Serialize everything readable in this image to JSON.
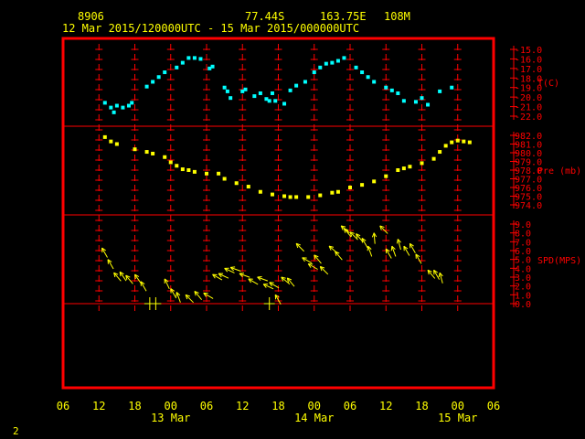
{
  "header": {
    "station_id": "8906",
    "latitude": "77.44S",
    "longitude": "163.75E",
    "elevation": "108M",
    "time_range": "12 Mar 2015/120000UTC - 15 Mar 2015/000000UTC"
  },
  "footer": {
    "page_number": "2"
  },
  "colors": {
    "frame": "#ff0000",
    "text": "#ffff00",
    "temperature": "#00ffff",
    "pressure": "#ffff00",
    "wind": "#ffff00"
  },
  "chart_data": {
    "type": "scatter",
    "x_axis": {
      "ticks": [
        "06",
        "12",
        "18",
        "00",
        "06",
        "12",
        "18",
        "00",
        "06",
        "12",
        "18",
        "00",
        "06"
      ],
      "tick_hours": [
        -6,
        0,
        6,
        12,
        18,
        24,
        30,
        36,
        42,
        48,
        54,
        60,
        66
      ],
      "date_labels": [
        {
          "text": "13 Mar",
          "hour": 12
        },
        {
          "text": "14 Mar",
          "hour": 36
        },
        {
          "text": "15 Mar",
          "hour": 60
        }
      ],
      "range_hours": [
        -6,
        66
      ]
    },
    "panels": [
      {
        "name": "temperature",
        "label": "T(C)",
        "ticks": [
          "-15.0",
          "-16.0",
          "-17.0",
          "-18.0",
          "-19.0",
          "-20.0",
          "-21.0",
          "-22.0"
        ],
        "range": [
          -22,
          -15
        ],
        "points": [
          [
            1,
            -20.6
          ],
          [
            2,
            -21.1
          ],
          [
            2.5,
            -21.6
          ],
          [
            3,
            -20.9
          ],
          [
            4,
            -21.1
          ],
          [
            5,
            -20.9
          ],
          [
            5.5,
            -20.6
          ],
          [
            8,
            -18.9
          ],
          [
            9,
            -18.4
          ],
          [
            10,
            -17.9
          ],
          [
            11,
            -17.4
          ],
          [
            13,
            -16.9
          ],
          [
            14,
            -16.4
          ],
          [
            15,
            -15.9
          ],
          [
            16,
            -15.9
          ],
          [
            17,
            -16.0
          ],
          [
            18.5,
            -17.0
          ],
          [
            19,
            -16.8
          ],
          [
            21,
            -19.0
          ],
          [
            21.5,
            -19.4
          ],
          [
            22,
            -20.1
          ],
          [
            24,
            -19.4
          ],
          [
            24.5,
            -19.2
          ],
          [
            26,
            -19.9
          ],
          [
            27,
            -19.6
          ],
          [
            28,
            -20.2
          ],
          [
            28.5,
            -20.4
          ],
          [
            29,
            -19.6
          ],
          [
            29.5,
            -20.4
          ],
          [
            31,
            -20.7
          ],
          [
            32,
            -19.3
          ],
          [
            33,
            -18.8
          ],
          [
            34.5,
            -18.4
          ],
          [
            36,
            -17.4
          ],
          [
            37,
            -16.9
          ],
          [
            38,
            -16.5
          ],
          [
            39,
            -16.4
          ],
          [
            40,
            -16.2
          ],
          [
            41,
            -15.9
          ],
          [
            43,
            -16.9
          ],
          [
            44,
            -17.4
          ],
          [
            45,
            -17.9
          ],
          [
            46,
            -18.4
          ],
          [
            48,
            -19.0
          ],
          [
            49,
            -19.3
          ],
          [
            50,
            -19.6
          ],
          [
            51,
            -20.4
          ],
          [
            53,
            -20.5
          ],
          [
            54,
            -20.1
          ],
          [
            55,
            -20.8
          ],
          [
            57,
            -19.4
          ],
          [
            59,
            -19.0
          ]
        ]
      },
      {
        "name": "pressure",
        "label": "Pre (mb)",
        "ticks": [
          "982.0",
          "981.0",
          "980.0",
          "979.0",
          "978.0",
          "977.0",
          "976.0",
          "975.0",
          "974.0"
        ],
        "range": [
          974,
          982
        ],
        "points": [
          [
            1,
            981.8
          ],
          [
            2,
            981.3
          ],
          [
            3,
            981.0
          ],
          [
            6,
            980.4
          ],
          [
            8,
            980.1
          ],
          [
            9,
            979.9
          ],
          [
            11,
            979.5
          ],
          [
            12,
            978.9
          ],
          [
            13,
            978.5
          ],
          [
            14,
            978.1
          ],
          [
            15,
            978.0
          ],
          [
            16,
            977.8
          ],
          [
            18,
            977.6
          ],
          [
            20,
            977.6
          ],
          [
            21,
            977.0
          ],
          [
            23,
            976.5
          ],
          [
            25,
            976.1
          ],
          [
            27,
            975.5
          ],
          [
            29,
            975.2
          ],
          [
            31,
            975.0
          ],
          [
            32,
            974.9
          ],
          [
            33,
            974.9
          ],
          [
            35,
            974.9
          ],
          [
            37,
            975.1
          ],
          [
            39,
            975.4
          ],
          [
            40,
            975.5
          ],
          [
            42,
            976.0
          ],
          [
            44,
            976.3
          ],
          [
            46,
            976.7
          ],
          [
            48,
            977.3
          ],
          [
            50,
            978.0
          ],
          [
            51,
            978.2
          ],
          [
            52,
            978.4
          ],
          [
            54,
            978.8
          ],
          [
            56,
            979.3
          ],
          [
            57,
            980.1
          ],
          [
            58,
            980.8
          ],
          [
            59,
            981.2
          ],
          [
            60,
            981.4
          ],
          [
            61,
            981.3
          ],
          [
            62,
            981.2
          ]
        ]
      },
      {
        "name": "wind",
        "label": "SPD(MPS)",
        "ticks": [
          "9.0",
          "8.0",
          "7.0",
          "6.0",
          "5.0",
          "4.0",
          "3.0",
          "2.0",
          "1.0",
          "0.0"
        ],
        "range": [
          0,
          9
        ],
        "barbs": [
          [
            0.5,
            6.3,
            150
          ],
          [
            1.5,
            5.0,
            150
          ],
          [
            2.5,
            3.5,
            140
          ],
          [
            3.5,
            3.6,
            145
          ],
          [
            4.5,
            3.2,
            140
          ],
          [
            6,
            3.3,
            145
          ],
          [
            7,
            2.5,
            150
          ],
          [
            8,
            0,
            0
          ],
          [
            9,
            0,
            0
          ],
          [
            11,
            2.8,
            155
          ],
          [
            12,
            1.7,
            150
          ],
          [
            13,
            1.3,
            160
          ],
          [
            14.5,
            1.0,
            135
          ],
          [
            16,
            1.4,
            140
          ],
          [
            17.5,
            1.2,
            120
          ],
          [
            19,
            3.3,
            120
          ],
          [
            20,
            3.4,
            115
          ],
          [
            21,
            4.0,
            115
          ],
          [
            22,
            4.1,
            110
          ],
          [
            23.5,
            3.4,
            110
          ],
          [
            25,
            2.8,
            120
          ],
          [
            26.5,
            3.0,
            110
          ],
          [
            27.5,
            2.2,
            115
          ],
          [
            28.5,
            2.4,
            120
          ],
          [
            29,
            0,
            0
          ],
          [
            29.5,
            1.0,
            150
          ],
          [
            30.5,
            3.0,
            130
          ],
          [
            31.5,
            2.9,
            140
          ],
          [
            33,
            6.8,
            135
          ],
          [
            34,
            5.2,
            120
          ],
          [
            35,
            4.5,
            120
          ],
          [
            36,
            5.5,
            140
          ],
          [
            37,
            4.2,
            135
          ],
          [
            38.5,
            6.5,
            130
          ],
          [
            39.5,
            5.9,
            140
          ],
          [
            40.5,
            8.8,
            130
          ],
          [
            41,
            8.5,
            140
          ],
          [
            42,
            8.1,
            135
          ],
          [
            43,
            7.9,
            140
          ],
          [
            44,
            7.4,
            150
          ],
          [
            45,
            6.5,
            160
          ],
          [
            46,
            8.0,
            175
          ],
          [
            47,
            8.8,
            135
          ],
          [
            48,
            6.2,
            150
          ],
          [
            49,
            6.5,
            160
          ],
          [
            50,
            7.3,
            165
          ],
          [
            51,
            6.5,
            150
          ],
          [
            52,
            6.8,
            150
          ],
          [
            53,
            5.6,
            150
          ],
          [
            55,
            3.8,
            140
          ],
          [
            56,
            3.8,
            150
          ],
          [
            57,
            3.5,
            165
          ]
        ],
        "calm_markers": [
          8.5,
          9.5,
          28.5
        ]
      }
    ]
  }
}
